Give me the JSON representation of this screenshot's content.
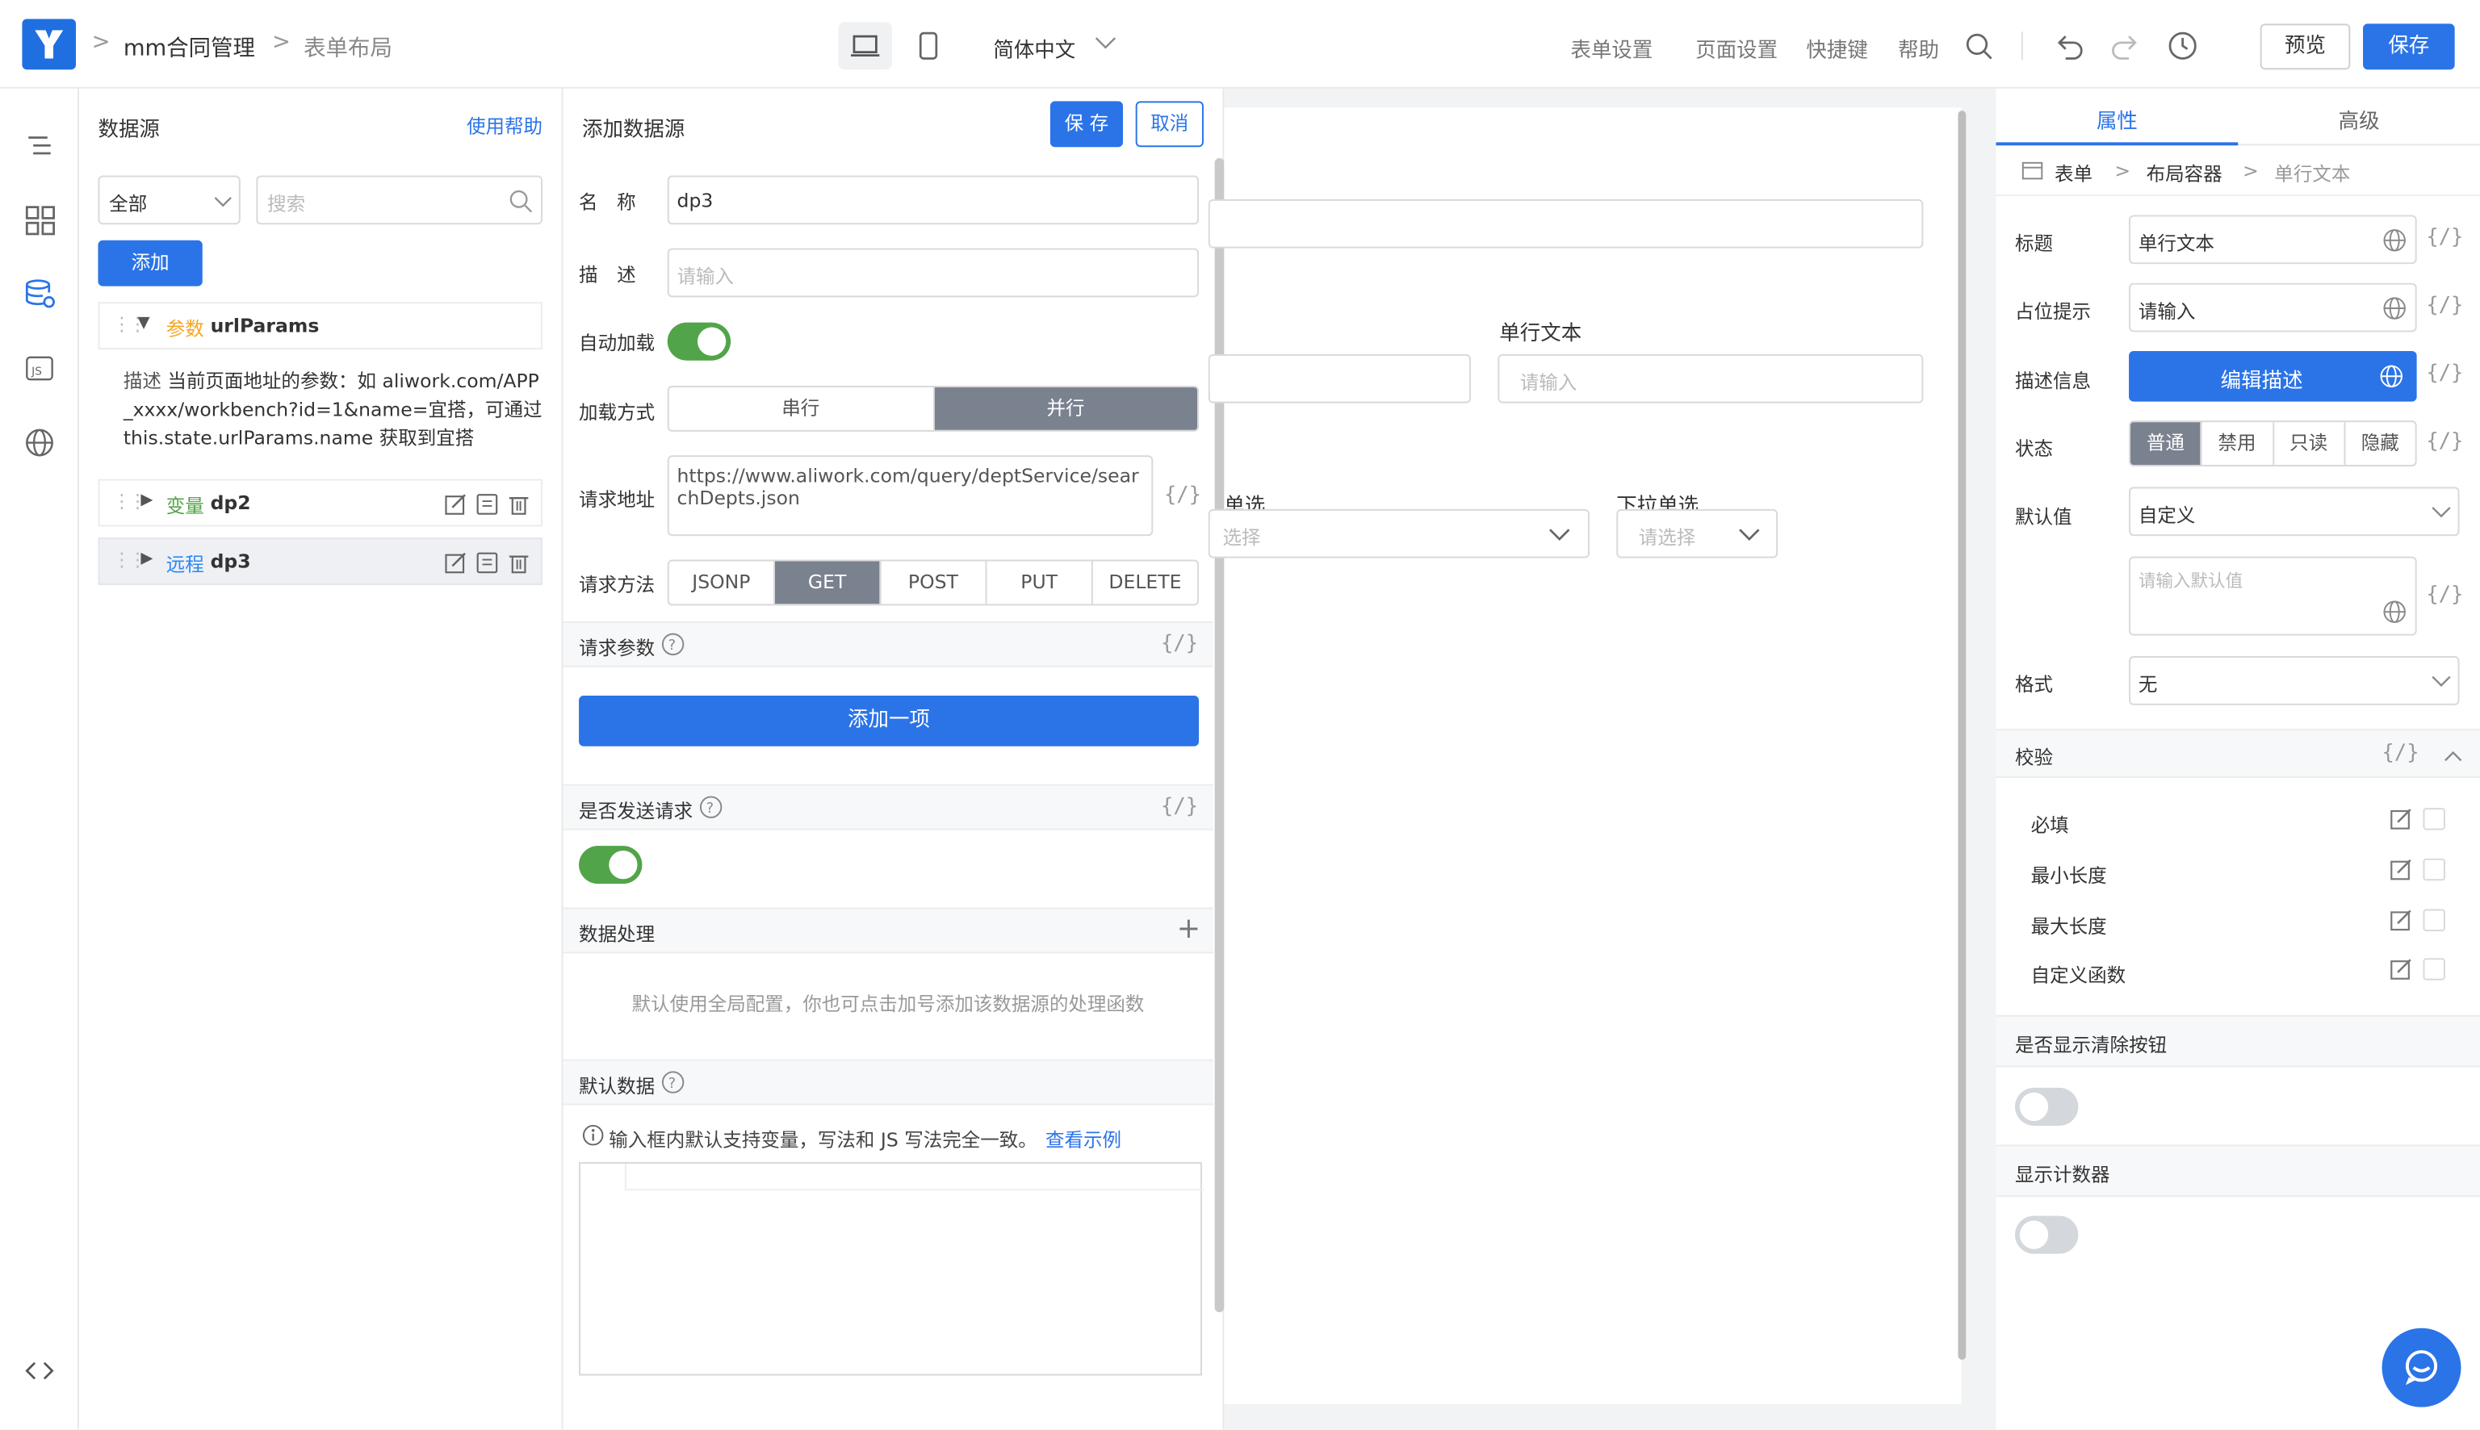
{
  "header": {
    "app_name": "mm合同管理",
    "page_name": "表单布局",
    "language": "简体中文",
    "menu": [
      "表单设置",
      "页面设置",
      "快捷键",
      "帮助"
    ],
    "preview_label": "预览",
    "save_label": "保存"
  },
  "datasource_panel": {
    "title": "数据源",
    "help_link": "使用帮助",
    "filter_value": "全部",
    "search_placeholder": "搜索",
    "add_label": "添加",
    "items": [
      {
        "tag": "参数",
        "name": "urlParams",
        "tag_color": "#f5a623"
      },
      {
        "tag": "变量",
        "name": "dp2",
        "tag_color": "#52a449"
      },
      {
        "tag": "远程",
        "name": "dp3",
        "tag_color": "#2b87f5"
      }
    ],
    "desc_label": "描述",
    "desc_text": "当前页面地址的参数：如 aliwork.com/APP_xxxx/workbench?id=1&name=宜搭，可通过 this.state.urlParams.name 获取到宜搭"
  },
  "add_panel": {
    "title": "添加数据源",
    "save_label": "保 存",
    "cancel_label": "取消",
    "name_label": "名　称",
    "name_value": "dp3",
    "desc_label": "描　述",
    "desc_placeholder": "请输入",
    "autoload_label": "自动加载",
    "autoload_on": true,
    "load_mode_label": "加载方式",
    "load_modes": [
      "串行",
      "并行"
    ],
    "load_mode_selected": "并行",
    "url_label": "请求地址",
    "url_value": "https://www.aliwork.com/query/deptService/searchDepts.json",
    "method_label": "请求方法",
    "methods": [
      "JSONP",
      "GET",
      "POST",
      "PUT",
      "DELETE"
    ],
    "method_selected": "GET",
    "params_label": "请求参数",
    "add_item_label": "添加一项",
    "send_label": "是否发送请求",
    "send_on": true,
    "process_label": "数据处理",
    "process_hint": "默认使用全局配置，你也可点击加号添加该数据源的处理函数",
    "default_label": "默认数据",
    "default_hint": "输入框内默认支持变量，写法和 JS 写法完全一致。",
    "default_link": "查看示例",
    "var_glyph": "{/}"
  },
  "canvas": {
    "field1_label": "单行文本",
    "field1_placeholder": "请输入",
    "radio_label": "单选",
    "radio_placeholder": "选择",
    "select_label": "下拉单选",
    "select_placeholder": "请选择"
  },
  "props_panel": {
    "tabs": [
      "属性",
      "高级"
    ],
    "active_tab": "属性",
    "breadcrumb": [
      "表单",
      "布局容器",
      "单行文本"
    ],
    "title_label": "标题",
    "title_value": "单行文本",
    "placeholder_label": "占位提示",
    "placeholder_value": "请输入",
    "desc_label": "描述信息",
    "desc_button": "编辑描述",
    "state_label": "状态",
    "states": [
      "普通",
      "禁用",
      "只读",
      "隐藏"
    ],
    "state_selected": "普通",
    "default_label": "默认值",
    "default_mode": "自定义",
    "default_placeholder": "请输入默认值",
    "format_label": "格式",
    "format_value": "无",
    "validation_label": "校验",
    "rules": [
      "必填",
      "最小长度",
      "最大长度",
      "自定义函数"
    ],
    "clear_label": "是否显示清除按钮",
    "counter_label": "显示计数器",
    "var_glyph": "{/}"
  },
  "colors": {
    "primary": "#2b74e8",
    "toggle_on": "#52a449",
    "segment_active": "#7a8290"
  }
}
